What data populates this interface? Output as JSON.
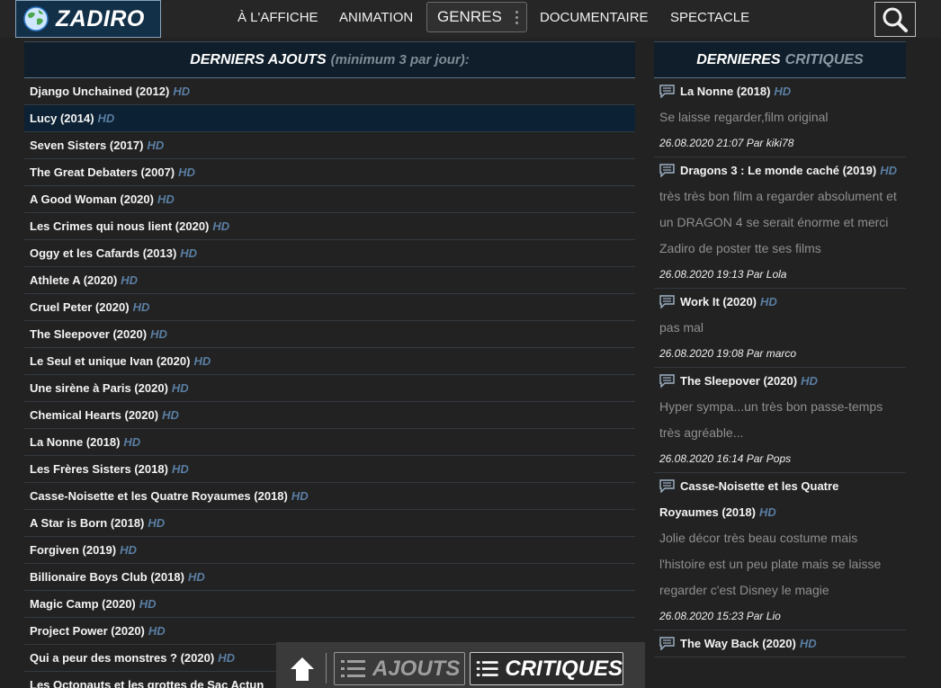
{
  "header": {
    "logo_text": "ZADIRO",
    "nav": [
      "À L'AFFICHE",
      "ANIMATION",
      "GENRES",
      "DOCUMENTAIRE",
      "SPECTACLE"
    ],
    "icons": {
      "search": "search-icon",
      "genres_menu": "more-vertical-icon",
      "logo": "globe-icon"
    }
  },
  "left_panel": {
    "title": "DERNIERS AJOUTS",
    "note": "(minimum 3 par jour):",
    "films": [
      {
        "title": "Django Unchained (2012)",
        "badge": "HD"
      },
      {
        "title": "Lucy (2014)",
        "badge": "HD"
      },
      {
        "title": "Seven Sisters (2017)",
        "badge": "HD"
      },
      {
        "title": "The Great Debaters (2007)",
        "badge": "HD"
      },
      {
        "title": "A Good Woman (2020)",
        "badge": "HD"
      },
      {
        "title": "Les Crimes qui nous lient (2020)",
        "badge": "HD"
      },
      {
        "title": "Oggy et les Cafards (2013)",
        "badge": "HD"
      },
      {
        "title": "Athlete A (2020)",
        "badge": "HD"
      },
      {
        "title": "Cruel Peter (2020)",
        "badge": "HD"
      },
      {
        "title": "The Sleepover (2020)",
        "badge": "HD"
      },
      {
        "title": "Le Seul et unique Ivan (2020)",
        "badge": "HD"
      },
      {
        "title": "Une sirène à Paris (2020)",
        "badge": "HD"
      },
      {
        "title": "Chemical Hearts (2020)",
        "badge": "HD"
      },
      {
        "title": "La Nonne (2018)",
        "badge": "HD"
      },
      {
        "title": "Les Frères Sisters (2018)",
        "badge": "HD"
      },
      {
        "title": "Casse-Noisette et les Quatre Royaumes (2018)",
        "badge": "HD"
      },
      {
        "title": "A Star is Born (2018)",
        "badge": "HD"
      },
      {
        "title": "Forgiven (2019)",
        "badge": "HD"
      },
      {
        "title": "Billionaire Boys Club (2018)",
        "badge": "HD"
      },
      {
        "title": "Magic Camp (2020)",
        "badge": "HD"
      },
      {
        "title": "Project Power (2020)",
        "badge": "HD"
      },
      {
        "title": "Qui a peur des monstres ? (2020)",
        "badge": "HD"
      },
      {
        "title": "Les Octonauts et les grottes de Sac Actun",
        "badge": ""
      }
    ]
  },
  "right_panel": {
    "title_a": "DERNIERES",
    "title_b": "CRITIQUES",
    "reviews": [
      {
        "film": "La Nonne (2018)",
        "badge": "HD",
        "text": "Se laisse regarder,film original",
        "meta": "26.08.2020 21:07 Par kiki78"
      },
      {
        "film": "Dragons 3 : Le monde caché (2019)",
        "badge": "HD",
        "text": "très très bon film a regarder absolument et un DRAGON 4 se serait énorme et merci Zadiro de poster tte ses films",
        "meta": "26.08.2020 19:13 Par Lola"
      },
      {
        "film": "Work It (2020)",
        "badge": "HD",
        "text": "pas mal",
        "meta": "26.08.2020 19:08 Par marco"
      },
      {
        "film": "The Sleepover (2020)",
        "badge": "HD",
        "text": "Hyper sympa...un très bon passe-temps très agréable...",
        "meta": "26.08.2020 16:14 Par Pops"
      },
      {
        "film": "Casse-Noisette et les Quatre Royaumes (2018)",
        "badge": "HD",
        "text": "Jolie décor très beau costume mais l'histoire est un peu plate mais se laisse regarder c'est Disney le magie",
        "meta": "26.08.2020 15:23 Par Lio"
      },
      {
        "film": "The Way Back (2020)",
        "badge": "HD",
        "text": "",
        "meta": ""
      }
    ]
  },
  "bottom_bar": {
    "ajouts_label": "AJOUTS",
    "critiques_label": "CRITIQUES",
    "icons": {
      "up": "arrow-up-icon",
      "list": "list-icon"
    }
  },
  "colors": {
    "bg": "#222222",
    "panel_head": "#0f1e2a",
    "hd": "#5a7ea3",
    "active_row": "#0c2133"
  }
}
